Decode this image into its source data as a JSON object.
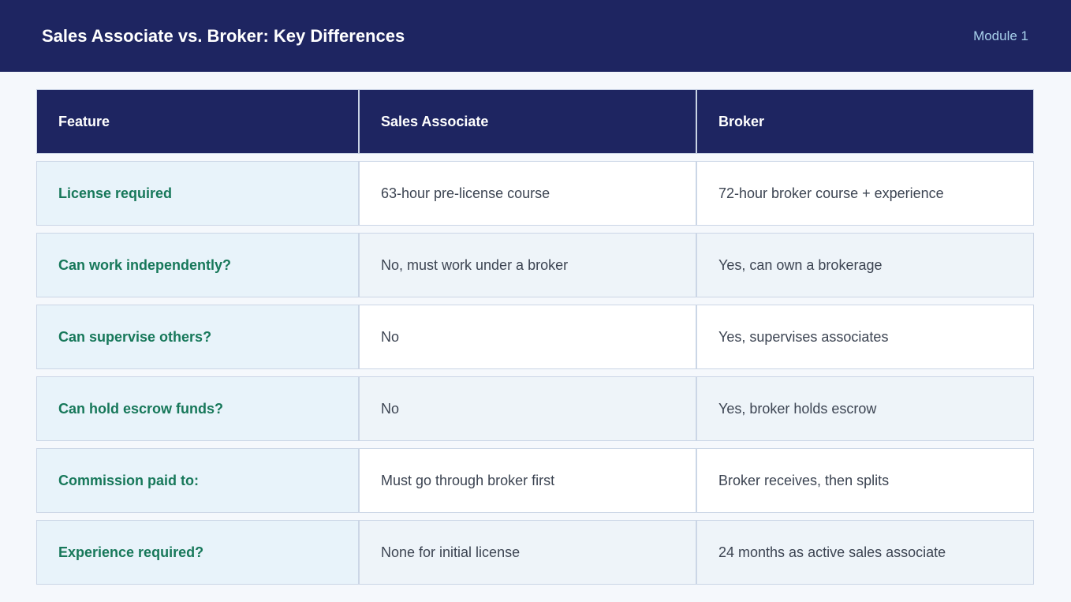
{
  "header": {
    "title": "Sales Associate vs. Broker: Key Differences",
    "module": "Module 1"
  },
  "table": {
    "columns": [
      "Feature",
      "Sales Associate",
      "Broker"
    ],
    "rows": [
      [
        "License required",
        "63-hour pre-license course",
        "72-hour broker course + experience"
      ],
      [
        "Can work independently?",
        "No, must work under a broker",
        "Yes, can own a brokerage"
      ],
      [
        "Can supervise others?",
        "No",
        "Yes, supervises associates"
      ],
      [
        "Can hold escrow funds?",
        "No",
        "Yes, broker holds escrow"
      ],
      [
        "Commission paid to:",
        "Must go through broker first",
        "Broker receives, then splits"
      ],
      [
        "Experience required?",
        "None for initial license",
        "24 months as active sales associate"
      ]
    ]
  },
  "colors": {
    "header_bg": "#1e2561",
    "module_text": "#a9d2ec",
    "feature_text": "#17785a",
    "feature_bg": "#e8f3fa",
    "page_bg": "#f5f8fc"
  }
}
